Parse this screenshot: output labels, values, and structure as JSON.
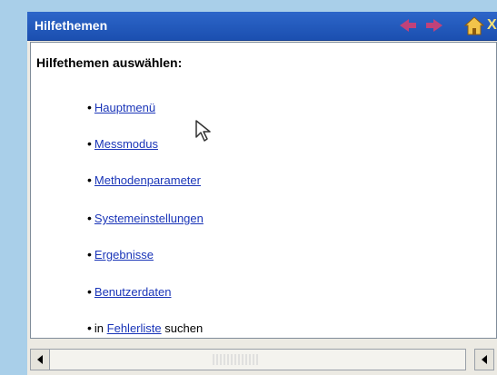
{
  "window": {
    "title": "Hilfethemen",
    "close_glyph": "X"
  },
  "content": {
    "heading": "Hilfethemen auswählen:",
    "topics": [
      {
        "label": "Hauptmenü"
      },
      {
        "label": "Messmodus"
      },
      {
        "label": "Methodenparameter"
      },
      {
        "label": "Systemeinstellungen"
      },
      {
        "label": "Ergebnisse"
      },
      {
        "label": "Benutzerdaten"
      }
    ],
    "search_prefix": "in",
    "search_link": "Fehlerliste",
    "search_suffix": "suchen"
  },
  "colors": {
    "titlebar": "#2356bd",
    "link": "#1a35b8",
    "nav_arrows": "#c0427a",
    "background": "#a9cfe9"
  },
  "icons": {
    "back": "back-arrow-icon",
    "forward": "forward-arrow-icon",
    "home": "home-icon",
    "close": "close-icon",
    "cursor": "mouse-pointer-icon"
  }
}
